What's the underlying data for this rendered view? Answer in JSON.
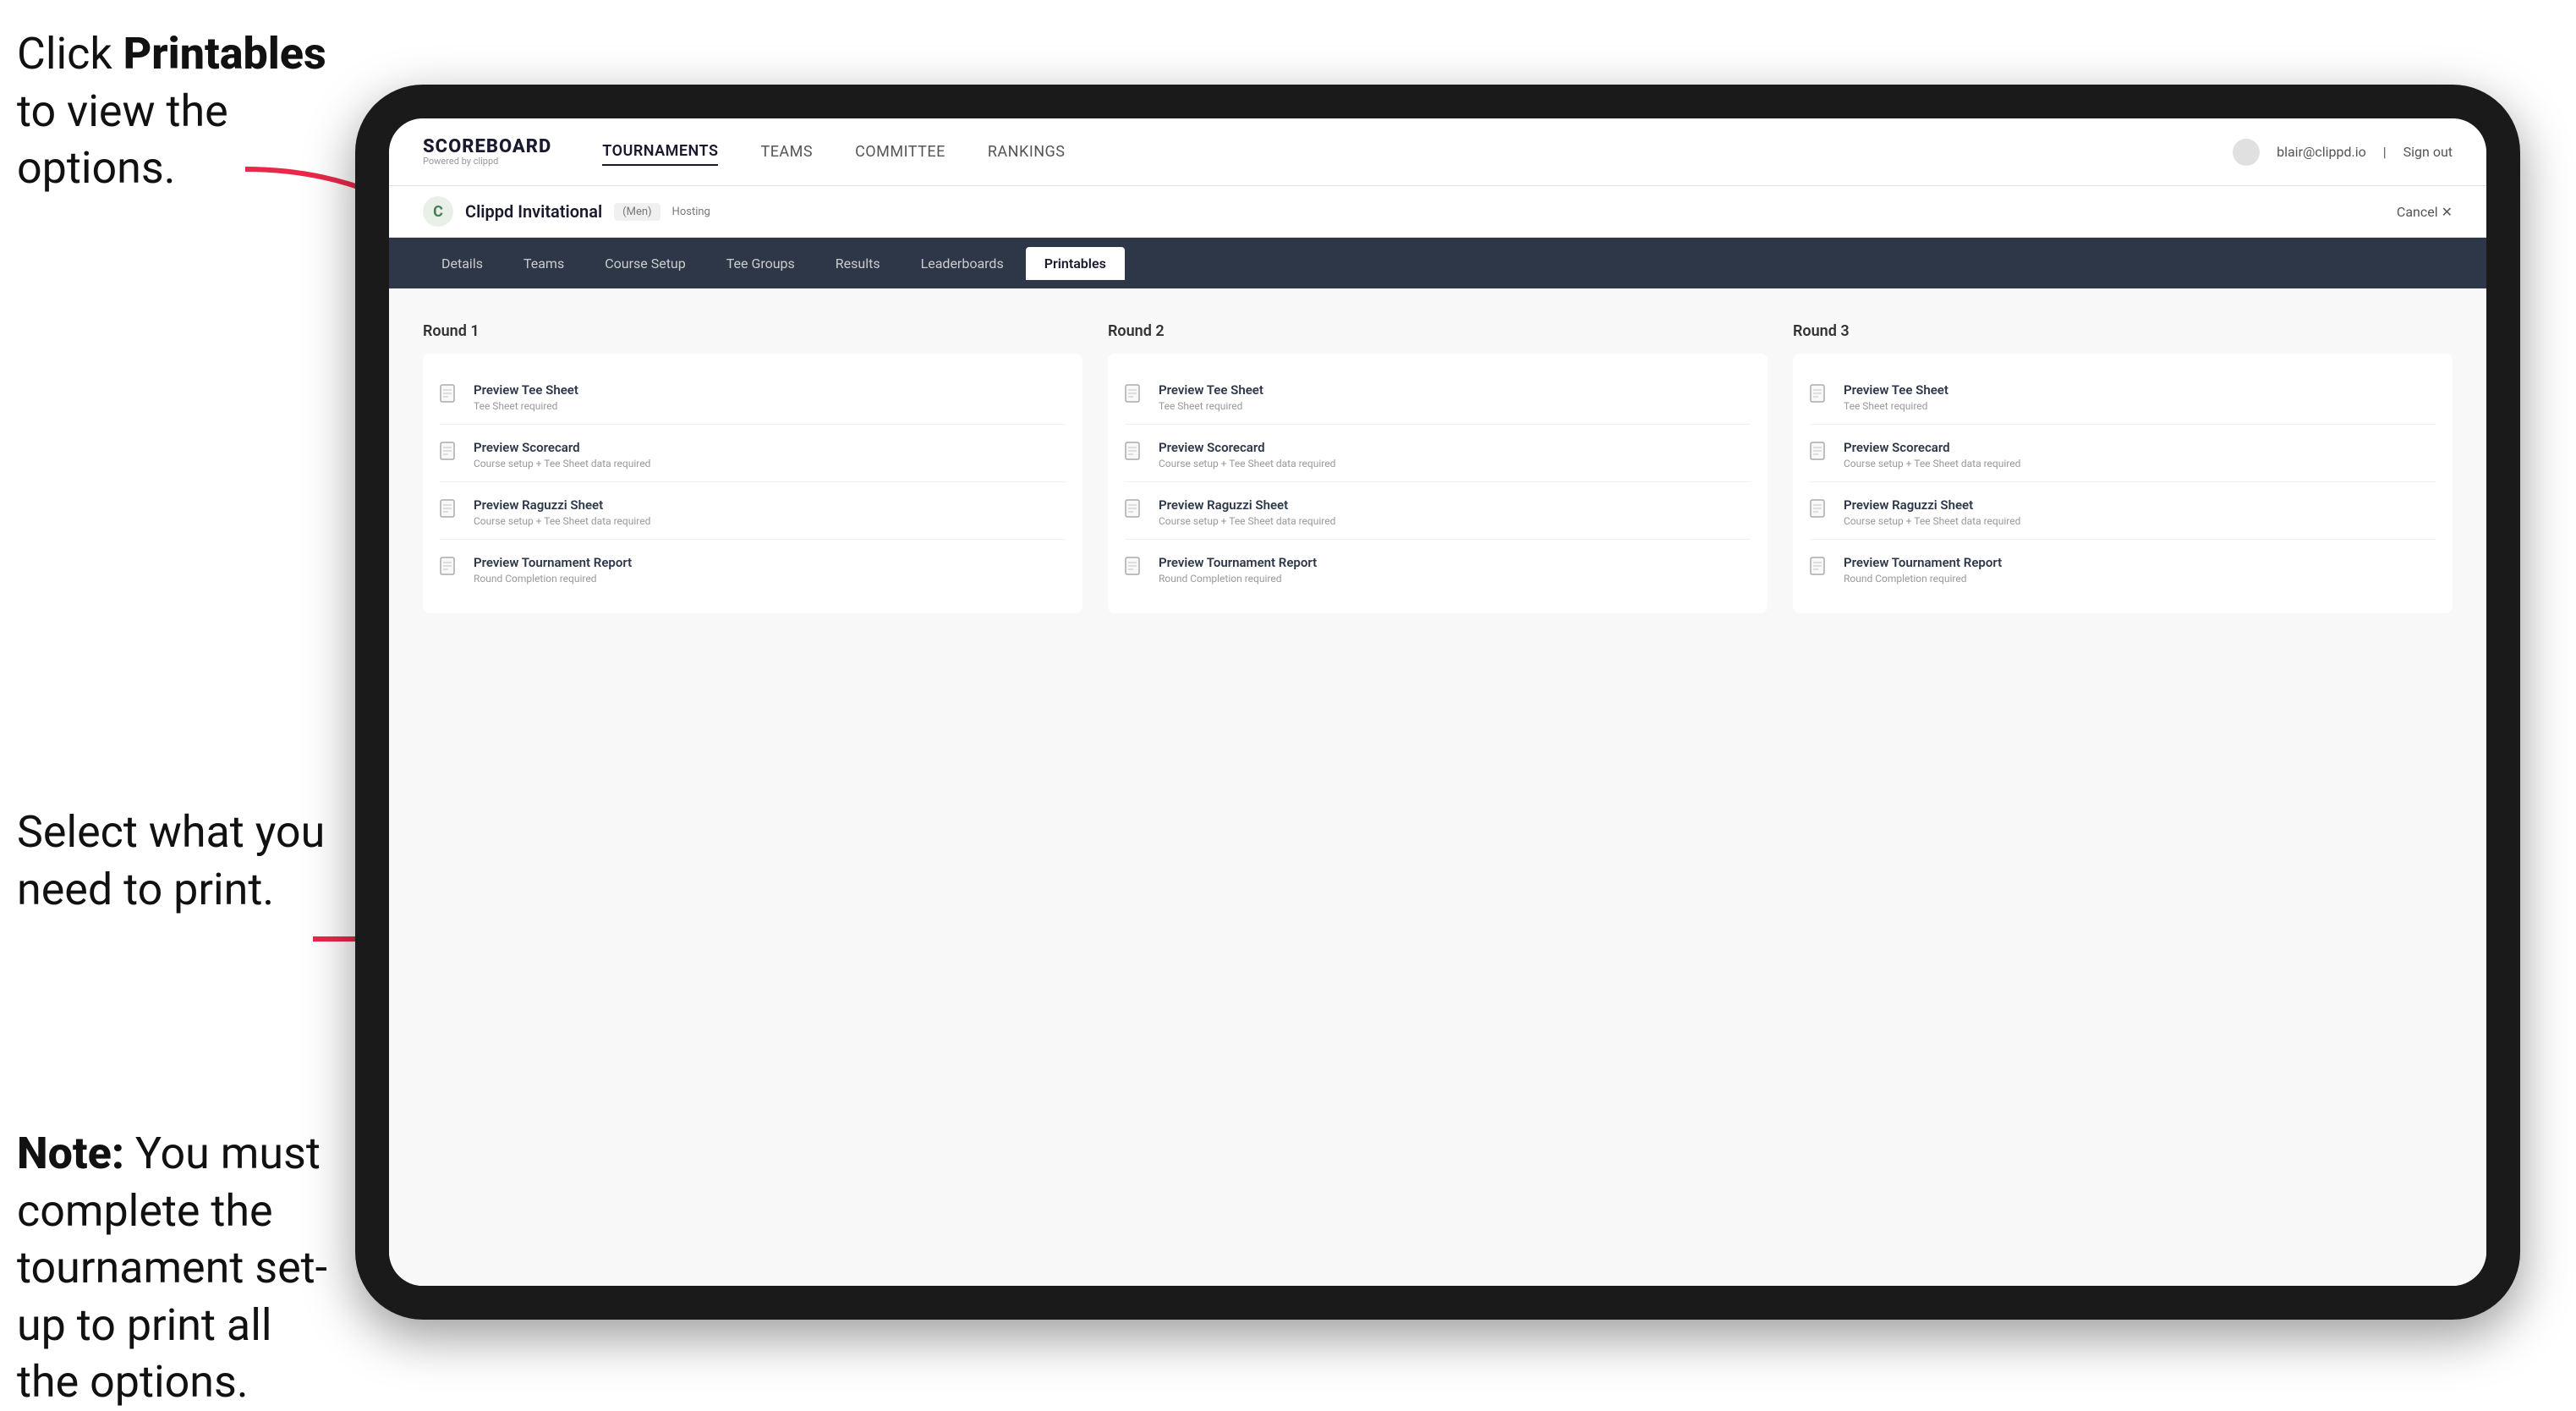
{
  "instructions": {
    "top_text_1": "Click ",
    "top_bold": "Printables",
    "top_text_2": " to view the options.",
    "middle_text": "Select what you need to print.",
    "bottom_bold": "Note:",
    "bottom_text": " You must complete the tournament set-up to print all the options."
  },
  "top_nav": {
    "logo_title": "SCOREBOARD",
    "logo_sub": "Powered by clippd",
    "links": [
      {
        "label": "TOURNAMENTS",
        "active": true
      },
      {
        "label": "TEAMS",
        "active": false
      },
      {
        "label": "COMMITTEE",
        "active": false
      },
      {
        "label": "RANKINGS",
        "active": false
      }
    ],
    "user_email": "blair@clippd.io",
    "sign_out": "Sign out"
  },
  "tournament_header": {
    "logo_letter": "C",
    "name": "Clippd Invitational",
    "badge": "(Men)",
    "hosting": "Hosting",
    "cancel": "Cancel ✕"
  },
  "sub_nav": {
    "items": [
      {
        "label": "Details",
        "active": false
      },
      {
        "label": "Teams",
        "active": false
      },
      {
        "label": "Course Setup",
        "active": false
      },
      {
        "label": "Tee Groups",
        "active": false
      },
      {
        "label": "Results",
        "active": false
      },
      {
        "label": "Leaderboards",
        "active": false
      },
      {
        "label": "Printables",
        "active": true
      }
    ]
  },
  "rounds": [
    {
      "title": "Round 1",
      "items": [
        {
          "title": "Preview Tee Sheet",
          "sub": "Tee Sheet required"
        },
        {
          "title": "Preview Scorecard",
          "sub": "Course setup + Tee Sheet data required"
        },
        {
          "title": "Preview Raguzzi Sheet",
          "sub": "Course setup + Tee Sheet data required"
        },
        {
          "title": "Preview Tournament Report",
          "sub": "Round Completion required"
        }
      ]
    },
    {
      "title": "Round 2",
      "items": [
        {
          "title": "Preview Tee Sheet",
          "sub": "Tee Sheet required"
        },
        {
          "title": "Preview Scorecard",
          "sub": "Course setup + Tee Sheet data required"
        },
        {
          "title": "Preview Raguzzi Sheet",
          "sub": "Course setup + Tee Sheet data required"
        },
        {
          "title": "Preview Tournament Report",
          "sub": "Round Completion required"
        }
      ]
    },
    {
      "title": "Round 3",
      "items": [
        {
          "title": "Preview Tee Sheet",
          "sub": "Tee Sheet required"
        },
        {
          "title": "Preview Scorecard",
          "sub": "Course setup + Tee Sheet data required"
        },
        {
          "title": "Preview Raguzzi Sheet",
          "sub": "Course setup + Tee Sheet data required"
        },
        {
          "title": "Preview Tournament Report",
          "sub": "Round Completion required"
        }
      ]
    }
  ]
}
